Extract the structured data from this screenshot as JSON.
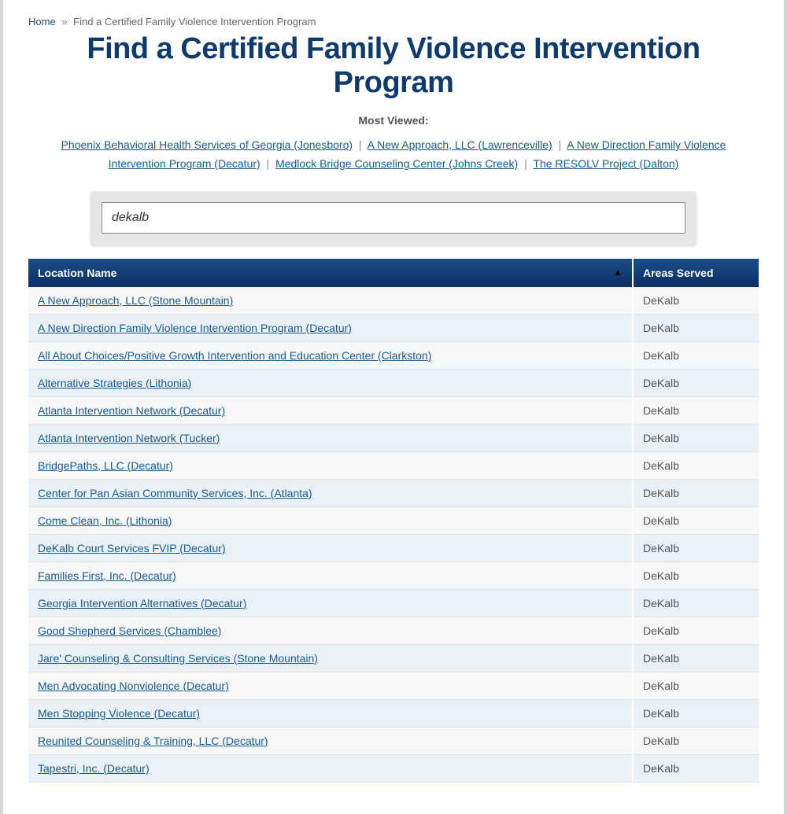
{
  "breadcrumb": {
    "home_label": "Home",
    "current": "Find a Certified Family Violence Intervention Program"
  },
  "page_title": "Find a Certified Family Violence Intervention Program",
  "most_viewed_label": "Most Viewed:",
  "most_viewed": [
    "Phoenix Behavioral Health Services of Georgia (Jonesboro)",
    "A New Approach, LLC (Lawrenceville)",
    "A New Direction Family Violence Intervention Program (Decatur)",
    "Medlock Bridge Counseling Center (Johns Creek)",
    "The RESOLV Project (Dalton)"
  ],
  "search": {
    "value": "dekalb"
  },
  "table": {
    "columns": {
      "name": "Location Name",
      "area": "Areas Served"
    },
    "sort_indicator": "▲",
    "rows": [
      {
        "name": "A New Approach, LLC (Stone Mountain)",
        "area": "DeKalb"
      },
      {
        "name": "A New Direction Family Violence Intervention Program (Decatur)",
        "area": "DeKalb"
      },
      {
        "name": "All About Choices/Positive Growth Intervention and Education Center (Clarkston)",
        "area": "DeKalb"
      },
      {
        "name": "Alternative Strategies (Lithonia)",
        "area": "DeKalb"
      },
      {
        "name": "Atlanta Intervention Network (Decatur)",
        "area": "DeKalb"
      },
      {
        "name": "Atlanta Intervention Network (Tucker)",
        "area": "DeKalb"
      },
      {
        "name": "BridgePaths, LLC (Decatur)",
        "area": "DeKalb"
      },
      {
        "name": "Center for Pan Asian Community Services, Inc. (Atlanta)",
        "area": "DeKalb"
      },
      {
        "name": "Come Clean, Inc. (Lithonia)",
        "area": "DeKalb"
      },
      {
        "name": "DeKalb Court Services FVIP (Decatur)",
        "area": "DeKalb"
      },
      {
        "name": "Families First, Inc. (Decatur)",
        "area": "DeKalb"
      },
      {
        "name": "Georgia Intervention Alternatives (Decatur)",
        "area": "DeKalb"
      },
      {
        "name": "Good Shepherd Services (Chamblee)",
        "area": "DeKalb"
      },
      {
        "name": "Jare' Counseling & Consulting Services (Stone Mountain)",
        "area": "DeKalb"
      },
      {
        "name": "Men Advocating Nonviolence (Decatur)",
        "area": "DeKalb"
      },
      {
        "name": "Men Stopping Violence (Decatur)",
        "area": "DeKalb"
      },
      {
        "name": "Reunited Counseling & Training, LLC (Decatur)",
        "area": "DeKalb"
      },
      {
        "name": "Tapestri, Inc. (Decatur)",
        "area": "DeKalb"
      }
    ]
  }
}
